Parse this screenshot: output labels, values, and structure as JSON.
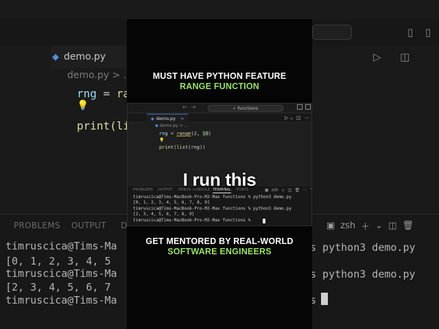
{
  "headline_top": {
    "line1": "MUST HAVE PYTHON FEATURE",
    "line2": "RANGE FUNCTION"
  },
  "headline_bottom": {
    "line1": "GET MENTORED BY REAL-WORLD",
    "line2": "SOFTWARE ENGINEERS"
  },
  "caption": "I run this",
  "colors": {
    "accent_green": "#9ae06b",
    "tab_accent": "#3b78c9"
  },
  "editor": {
    "search_text": "functions",
    "tab_label": "demo.py",
    "tab_close": "×",
    "breadcrumb_file": "demo.py",
    "breadcrumb_sep": "> ...",
    "code": {
      "line1_var": "rng",
      "line1_eq": " = ",
      "line1_fn": "range",
      "line1_open": "(",
      "line1_arg1": "2",
      "line1_comma": ", ",
      "line1_arg2": "10",
      "line1_close": ")",
      "line2_print": "print",
      "line2_open": "(",
      "line2_list": "list",
      "line2_args": "(rng))"
    }
  },
  "panel": {
    "tabs": [
      "PROBLEMS",
      "OUTPUT",
      "DEBUG CONSOLE",
      "TERMINAL",
      "PORTS"
    ],
    "active_tab": "TERMINAL",
    "shell": "zsh",
    "terminal_lines": [
      "timruscica@Tims-MacBook-Pro-M2-Max functions % python3 demo.py",
      "[0, 1, 2, 3, 4, 5, 6, 7, 8, 9]",
      "timruscica@Tims-MacBook-Pro-M2-Max functions % python3 demo.py",
      "[2, 3, 4, 5, 6, 7, 8, 9]",
      "timruscica@Tims-MacBook-Pro-M2-Max functions % "
    ]
  },
  "background": {
    "tab_label": "demo.py",
    "breadcrumb": "demo.py > ...",
    "code_line1_var": "rng",
    "code_line1_eq": " = ",
    "code_line1_fn": "ra",
    "code_line2": "print(li",
    "panel_tab_problems": "PROBLEMS",
    "panel_tab_output": "OUTPUT",
    "panel_tab_debug": "D",
    "shell": "zsh",
    "term_left": [
      "timruscica@Tims-Ma",
      "[0, 1, 2, 3, 4, 5",
      "timruscica@Tims-Ma",
      "[2, 3, 4, 5, 6, 7",
      "timruscica@Tims-Ma"
    ],
    "term_right": [
      "s python3 demo.py",
      "s python3 demo.py",
      "s "
    ]
  },
  "icons": {
    "file": "python-file-icon",
    "lightbulb": "lightbulb-icon",
    "run": "run-icon",
    "split": "split-editor-icon",
    "more": "more-icon",
    "add": "add-terminal-icon",
    "trash": "trash-icon"
  }
}
